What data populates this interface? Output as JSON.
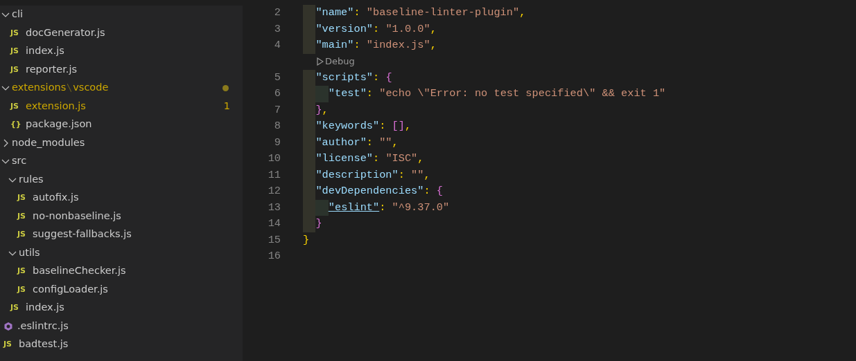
{
  "explorer": {
    "tree": [
      {
        "kind": "folder",
        "label": "cli",
        "expanded": true,
        "children": [
          {
            "kind": "js",
            "icon_label": "JS",
            "label": "docGenerator.js"
          },
          {
            "kind": "js",
            "icon_label": "JS",
            "label": "index.js"
          },
          {
            "kind": "js",
            "icon_label": "JS",
            "label": "reporter.js"
          }
        ]
      },
      {
        "kind": "folder",
        "label": "extensions",
        "label_suffix": "vscode",
        "expanded": true,
        "warning": true,
        "modified": true,
        "children": [
          {
            "kind": "js",
            "icon_label": "JS",
            "label": "extension.js",
            "warning": true,
            "badge": "1"
          },
          {
            "kind": "json",
            "icon_label": "{}",
            "label": "package.json"
          }
        ]
      },
      {
        "kind": "folder",
        "label": "node_modules",
        "expanded": false
      },
      {
        "kind": "folder",
        "label": "src",
        "expanded": true,
        "children": [
          {
            "kind": "folder",
            "label": "rules",
            "expanded": true,
            "children": [
              {
                "kind": "js",
                "icon_label": "JS",
                "label": "autofix.js"
              },
              {
                "kind": "js",
                "icon_label": "JS",
                "label": "no-nonbaseline.js"
              },
              {
                "kind": "js",
                "icon_label": "JS",
                "label": "suggest-fallbacks.js"
              }
            ]
          },
          {
            "kind": "folder",
            "label": "utils",
            "expanded": true,
            "children": [
              {
                "kind": "js",
                "icon_label": "JS",
                "label": "baselineChecker.js"
              },
              {
                "kind": "js",
                "icon_label": "JS",
                "label": "configLoader.js"
              }
            ]
          },
          {
            "kind": "js",
            "icon_label": "JS",
            "label": "index.js"
          }
        ]
      },
      {
        "kind": "eslint",
        "label": ".eslintrc.js"
      },
      {
        "kind": "js",
        "icon_label": "JS",
        "label": "badtest.js"
      }
    ]
  },
  "editor": {
    "lines": [
      {
        "kind": "block",
        "children": [
          {
            "kind": "line",
            "number": "2",
            "tokens": [
              {
                "kind": "key",
                "text": "\"name\""
              },
              {
                "kind": "punct",
                "text": ": "
              },
              {
                "kind": "string",
                "text": "\"baseline-linter-plugin\""
              },
              {
                "kind": "punct",
                "text": ","
              }
            ]
          },
          {
            "kind": "line",
            "number": "3",
            "tokens": [
              {
                "kind": "key",
                "text": "\"version\""
              },
              {
                "kind": "punct",
                "text": ": "
              },
              {
                "kind": "string",
                "text": "\"1.0.0\""
              },
              {
                "kind": "punct",
                "text": ","
              }
            ]
          },
          {
            "kind": "line",
            "number": "4",
            "tokens": [
              {
                "kind": "key",
                "text": "\"main\""
              },
              {
                "kind": "punct",
                "text": ": "
              },
              {
                "kind": "string",
                "text": "\"index.js\""
              },
              {
                "kind": "punct",
                "text": ","
              }
            ]
          },
          {
            "kind": "codelens",
            "text": "Debug"
          },
          {
            "kind": "line",
            "number": "5",
            "tokens": [
              {
                "kind": "key",
                "text": "\"scripts\""
              },
              {
                "kind": "punct",
                "text": ": "
              },
              {
                "kind": "bracket",
                "text": "{"
              }
            ],
            "children": [
              {
                "kind": "line",
                "number": "6",
                "tokens": [
                  {
                    "kind": "key",
                    "text": "\"test\""
                  },
                  {
                    "kind": "punct",
                    "text": ": "
                  },
                  {
                    "kind": "string",
                    "text": "\"echo \\\"Error: no test specified\\\" && exit 1\""
                  }
                ]
              }
            ]
          },
          {
            "kind": "line",
            "number": "7",
            "tokens": [
              {
                "kind": "bracket",
                "text": "}"
              },
              {
                "kind": "punct",
                "text": ","
              }
            ]
          },
          {
            "kind": "line",
            "number": "8",
            "tokens": [
              {
                "kind": "key",
                "text": "\"keywords\""
              },
              {
                "kind": "punct",
                "text": ": "
              },
              {
                "kind": "bracket",
                "text": "[]"
              },
              {
                "kind": "punct",
                "text": ","
              }
            ]
          },
          {
            "kind": "line",
            "number": "9",
            "tokens": [
              {
                "kind": "key",
                "text": "\"author\""
              },
              {
                "kind": "punct",
                "text": ": "
              },
              {
                "kind": "string",
                "text": "\"\""
              },
              {
                "kind": "punct",
                "text": ","
              }
            ]
          },
          {
            "kind": "line",
            "number": "10",
            "tokens": [
              {
                "kind": "key",
                "text": "\"license\""
              },
              {
                "kind": "punct",
                "text": ": "
              },
              {
                "kind": "string",
                "text": "\"ISC\""
              },
              {
                "kind": "punct",
                "text": ","
              }
            ]
          },
          {
            "kind": "line",
            "number": "11",
            "tokens": [
              {
                "kind": "key",
                "text": "\"description\""
              },
              {
                "kind": "punct",
                "text": ": "
              },
              {
                "kind": "string",
                "text": "\"\""
              },
              {
                "kind": "punct",
                "text": ","
              }
            ]
          },
          {
            "kind": "line",
            "number": "12",
            "tokens": [
              {
                "kind": "key",
                "text": "\"devDependencies\""
              },
              {
                "kind": "punct",
                "text": ": "
              },
              {
                "kind": "bracket",
                "text": "{"
              }
            ],
            "children": [
              {
                "kind": "line",
                "number": "13",
                "tokens": [
                  {
                    "kind": "key-link",
                    "text": "\"eslint\""
                  },
                  {
                    "kind": "punct",
                    "text": ": "
                  },
                  {
                    "kind": "string",
                    "text": "\"^9.37.0\""
                  }
                ]
              }
            ]
          },
          {
            "kind": "line",
            "number": "14",
            "tokens": [
              {
                "kind": "bracket",
                "text": "}"
              }
            ]
          }
        ]
      },
      {
        "kind": "line",
        "number": "15",
        "tokens": [
          {
            "kind": "brace",
            "text": "}"
          }
        ]
      },
      {
        "kind": "line",
        "number": "16"
      }
    ]
  }
}
